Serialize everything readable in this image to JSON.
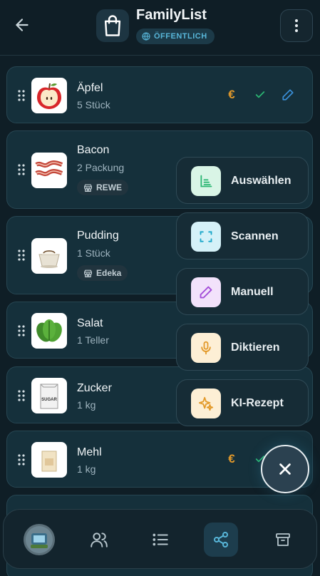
{
  "header": {
    "title": "FamilyList",
    "visibility": "ÖFFENTLICH"
  },
  "items": [
    {
      "name": "Äpfel",
      "qty": "5 Stück",
      "store": "",
      "image": "apple"
    },
    {
      "name": "Bacon",
      "qty": "2 Packung",
      "store": "REWE",
      "image": "bacon"
    },
    {
      "name": "Pudding",
      "qty": "1 Stück",
      "store": "Edeka",
      "image": "pudding"
    },
    {
      "name": "Salat",
      "qty": "1 Teller",
      "store": "",
      "image": "salad"
    },
    {
      "name": "Zucker",
      "qty": "1 kg",
      "store": "",
      "image": "sugar"
    },
    {
      "name": "Mehl",
      "qty": "1 kg",
      "store": "",
      "image": "flour"
    }
  ],
  "item_image_labels": {
    "sugar": "SUGAR"
  },
  "add_menu": [
    {
      "label": "Auswählen",
      "icon": "chart-select-icon",
      "color": "#2bb673"
    },
    {
      "label": "Scannen",
      "icon": "scan-icon",
      "color": "#1aa6c9"
    },
    {
      "label": "Manuell",
      "icon": "pencil-icon",
      "color": "#a24bd8"
    },
    {
      "label": "Diktieren",
      "icon": "microphone-icon",
      "color": "#e39a2b"
    },
    {
      "label": "KI-Rezept",
      "icon": "sparkles-icon",
      "color": "#e39a2b"
    }
  ],
  "colors": {
    "accent": "#58b6d9",
    "euro": "#e39a2b",
    "check": "#2bb673",
    "edit": "#3a8fd8"
  },
  "bottom_nav": [
    "avatar",
    "users-icon",
    "list-icon",
    "share-icon",
    "archive-icon"
  ],
  "active_nav": "share-icon"
}
